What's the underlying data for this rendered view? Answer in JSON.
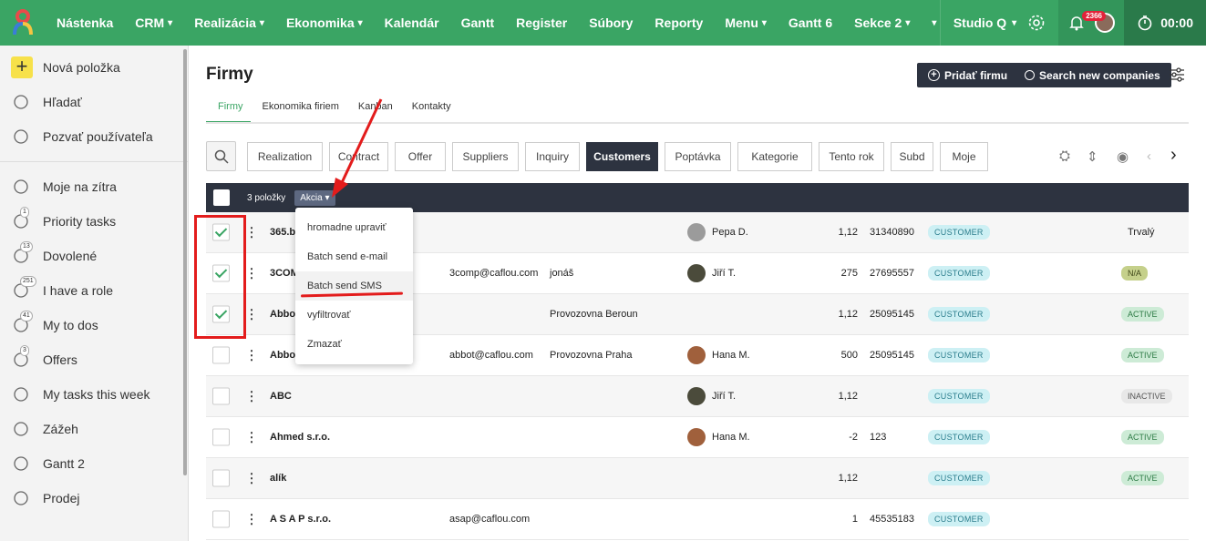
{
  "nav": {
    "items": [
      "Nástenka",
      "CRM",
      "Realizácia",
      "Ekonomika",
      "Kalendár",
      "Gantt",
      "Register",
      "Súbory",
      "Reporty",
      "Menu",
      "Gantt 6",
      "Sekce 2"
    ],
    "has_chevron": [
      false,
      true,
      true,
      true,
      false,
      false,
      false,
      false,
      false,
      true,
      false,
      true
    ],
    "more": "▾",
    "studio": "Studio Q",
    "notif_count": "2366",
    "timer": "00:00"
  },
  "sidebar": {
    "top": [
      {
        "label": "Nová položka",
        "icon": "plus-icon"
      },
      {
        "label": "Hľadať",
        "icon": "search-icon"
      },
      {
        "label": "Pozvať používateľa",
        "icon": "invite-user-icon"
      }
    ],
    "items": [
      {
        "label": "Moje na zítra",
        "icon": "clock-icon",
        "count": ""
      },
      {
        "label": "Priority tasks",
        "icon": "priority-icon",
        "count": "1"
      },
      {
        "label": "Dovolené",
        "icon": "anchor-icon",
        "count": "13"
      },
      {
        "label": "I have a role",
        "icon": "search-role-icon",
        "count": "251"
      },
      {
        "label": "My to dos",
        "icon": "check-circle-icon",
        "count": "41"
      },
      {
        "label": "Offers",
        "icon": "document-icon",
        "count": "3"
      },
      {
        "label": "My tasks this week",
        "icon": "clock-icon",
        "count": ""
      },
      {
        "label": "Zážeh",
        "icon": "flame-icon",
        "count": ""
      },
      {
        "label": "Gantt 2",
        "icon": "archive-icon",
        "count": ""
      },
      {
        "label": "Prodej",
        "icon": "handshake-icon",
        "count": ""
      }
    ]
  },
  "page": {
    "title": "Firmy",
    "add_button": "Pridať firmu",
    "search_button": "Search new companies",
    "tabs": [
      "Firmy",
      "Ekonomika firiem",
      "Kanban",
      "Kontakty"
    ],
    "filters": [
      "Realization",
      "Contract",
      "Offer",
      "Suppliers",
      "Inquiry",
      "Customers",
      "Poptávka",
      "Kategorie",
      "Tento rok",
      "Subd",
      "Moje"
    ],
    "active_filter": "Customers"
  },
  "table": {
    "count_label": "3 položky",
    "action_label": "Akcia ▾",
    "rows": [
      {
        "name": "365.b",
        "email": "",
        "location": "",
        "person": "Pepa D.",
        "num": "1,12",
        "ico": "31340890",
        "tag": "CUSTOMER",
        "status": "Trvalý",
        "status_type": "plain",
        "checked": true,
        "avatar": "#9b9b9b"
      },
      {
        "name": "3COM",
        "email": "3comp@caflou.com",
        "location": "jonáš",
        "person": "Jiří T.",
        "num": "275",
        "ico": "27695557",
        "tag": "CUSTOMER",
        "status": "N/A",
        "status_type": "na",
        "checked": true,
        "avatar": "#4b4b3b"
      },
      {
        "name": "Abbo",
        "email": "",
        "location": "Provozovna Beroun",
        "person": "",
        "num": "1,12",
        "ico": "25095145",
        "tag": "CUSTOMER",
        "status": "ACTIVE",
        "status_type": "active",
        "checked": true,
        "avatar": ""
      },
      {
        "name": "Abbo",
        "email": "abbot@caflou.com",
        "location": "Provozovna Praha",
        "person": "Hana M.",
        "num": "500",
        "ico": "25095145",
        "tag": "CUSTOMER",
        "status": "ACTIVE",
        "status_type": "active",
        "checked": false,
        "avatar": "#a0603c"
      },
      {
        "name": "ABC",
        "email": "",
        "location": "",
        "person": "Jiří T.",
        "num": "1,12",
        "ico": "",
        "tag": "CUSTOMER",
        "status": "INACTIVE",
        "status_type": "inactive",
        "checked": false,
        "avatar": "#4b4b3b"
      },
      {
        "name": "Ahmed s.r.o.",
        "email": "",
        "location": "",
        "person": "Hana M.",
        "num": "-2",
        "ico": "123",
        "tag": "CUSTOMER",
        "status": "ACTIVE",
        "status_type": "active",
        "checked": false,
        "avatar": "#a0603c"
      },
      {
        "name": "alík",
        "email": "",
        "location": "",
        "person": "",
        "num": "1,12",
        "ico": "",
        "tag": "CUSTOMER",
        "status": "ACTIVE",
        "status_type": "active",
        "checked": false,
        "avatar": ""
      },
      {
        "name": "A S A P s.r.o.",
        "email": "asap@caflou.com",
        "location": "",
        "person": "",
        "num": "1",
        "ico": "45535183",
        "tag": "CUSTOMER",
        "status": "",
        "status_type": "plain",
        "checked": false,
        "avatar": ""
      }
    ]
  },
  "dropdown": {
    "items": [
      "hromadne upraviť",
      "Batch send e-mail",
      "Batch send SMS",
      "vyfiltrovať",
      "Zmazať"
    ],
    "highlighted": "Batch send SMS"
  },
  "annotation_color": "#e31c1c",
  "accent": "#3aa564"
}
